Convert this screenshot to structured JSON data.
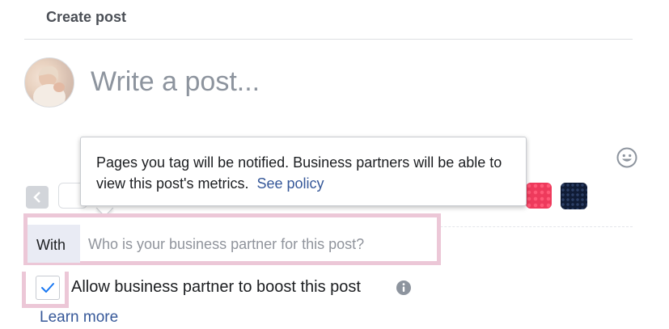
{
  "header": {
    "title": "Create post"
  },
  "composer": {
    "placeholder": "Write a post..."
  },
  "tooltip": {
    "message": "Pages you tag will be notified. Business partners will be able to view this post's metrics.",
    "link": "See policy"
  },
  "tag_partner": {
    "label": "With",
    "placeholder": "Who is your business partner for this post?"
  },
  "boost": {
    "label": "Allow business partner to boost this post",
    "checked": true,
    "learn_more": "Learn more"
  },
  "background_colors": [
    "#ffffff",
    "#ee3a5c",
    "#101c36"
  ],
  "icons": {
    "emoji": "emoji-icon",
    "prev": "chevron-left-icon",
    "info": "info-icon",
    "check": "check-icon"
  },
  "colors": {
    "link": "#365899",
    "highlight_border": "#ecc7d7",
    "check": "#1877f2"
  }
}
